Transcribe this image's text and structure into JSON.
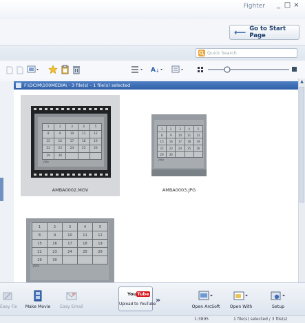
{
  "window": {
    "title": "Fighter"
  },
  "header": {
    "start_page_label": "Go to Start Page"
  },
  "search": {
    "placeholder": "Quick Search"
  },
  "path_bar": {
    "text": "F:\\DCIM\\100MEDIA\\ - 3 file(s) - 1 file(s) selected"
  },
  "files": [
    {
      "name": "AMBA0002.MOV",
      "selected": true,
      "type": "video"
    },
    {
      "name": "AMBA0003.JPG",
      "selected": false,
      "type": "photo"
    },
    {
      "name": "",
      "selected": false,
      "type": "photo"
    }
  ],
  "calendar_rows": [
    [
      "1",
      "2",
      "3",
      "4",
      "5"
    ],
    [
      "8",
      "9",
      "10",
      "11",
      "12"
    ],
    [
      "15",
      "16",
      "17",
      "18",
      "19"
    ],
    [
      "22",
      "23",
      "24",
      "25",
      "26"
    ],
    [
      "29",
      "30",
      "",
      "",
      ""
    ]
  ],
  "calendar_month": "July",
  "bottom_toolbar": {
    "easy_fix": "Easy Fix",
    "make_movie": "Make Movie",
    "easy_email": "Easy Email",
    "upload_youtube": "Upload to YouTube",
    "youtube_you": "You",
    "youtube_tube": "Tube",
    "more": "»",
    "open_arcsoft": "Open ArcSoft",
    "open_with": "Open With",
    "setup": "Setup"
  },
  "status": {
    "zoom": "1:3895",
    "selection": "1 file(s) selected / 3 file(s)"
  },
  "colors": {
    "accent": "#2f5fa6",
    "youtube_red": "#d8141b",
    "selection": "#d6d8dc"
  }
}
